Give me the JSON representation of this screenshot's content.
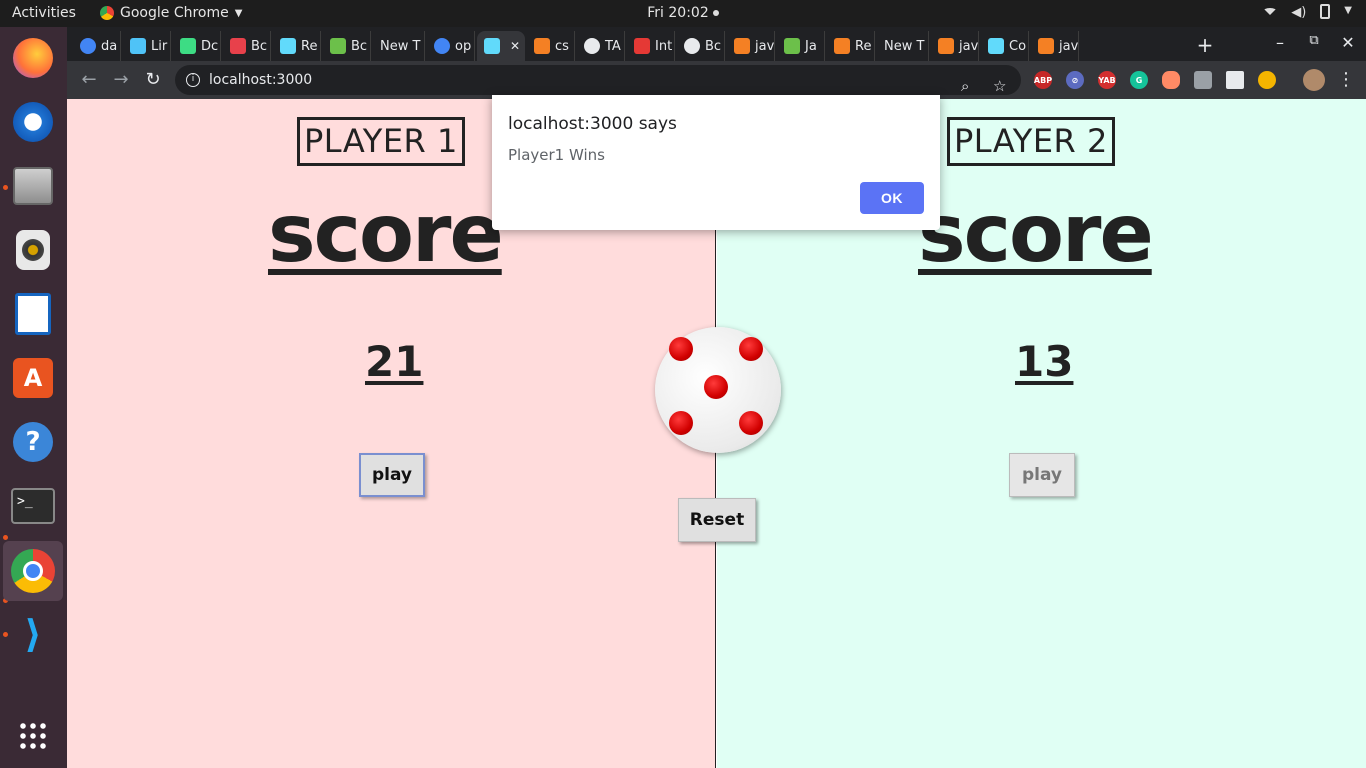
{
  "topbar": {
    "activities": "Activities",
    "app_name": "Google Chrome",
    "clock": "Fri 20:02"
  },
  "dock": {
    "apps": [
      "firefox-icon",
      "thunderbird-icon",
      "files-icon",
      "rhythmbox-icon",
      "writer-icon",
      "software-center-icon",
      "help-icon",
      "terminal-icon",
      "chrome-icon",
      "vscode-icon",
      "show-apps-icon"
    ]
  },
  "tabs": [
    {
      "label": "da",
      "icon": "google-icon",
      "color": "#4285f4"
    },
    {
      "label": "Lir",
      "icon": "flutter-icon",
      "color": "#4fc3f7"
    },
    {
      "label": "Dc",
      "icon": "android-icon",
      "color": "#3ddc84"
    },
    {
      "label": "Bc",
      "icon": "bootstrap-icon",
      "color": "#e8414b"
    },
    {
      "label": "Re",
      "icon": "react-icon",
      "color": "#61dafb"
    },
    {
      "label": "Bc",
      "icon": "chart-icon",
      "color": "#6cc04a"
    },
    {
      "label": "New T",
      "icon": "",
      "color": ""
    },
    {
      "label": "op",
      "icon": "google-icon",
      "color": "#4285f4"
    },
    {
      "label": "",
      "icon": "react-icon",
      "color": "#61dafb",
      "active": true
    },
    {
      "label": "cs",
      "icon": "stackoverflow-icon",
      "color": "#f48024"
    },
    {
      "label": "TA",
      "icon": "globe-icon",
      "color": "#e8eaed"
    },
    {
      "label": "Int",
      "icon": "arc-icon",
      "color": "#e53935"
    },
    {
      "label": "Bc",
      "icon": "globe-icon",
      "color": "#e8eaed"
    },
    {
      "label": "jav",
      "icon": "stackoverflow-icon",
      "color": "#f48024"
    },
    {
      "label": "Ja",
      "icon": "chart-icon",
      "color": "#6cc04a"
    },
    {
      "label": "Re",
      "icon": "stackoverflow-icon",
      "color": "#f48024"
    },
    {
      "label": "New T",
      "icon": "",
      "color": ""
    },
    {
      "label": "jav",
      "icon": "stackoverflow-icon",
      "color": "#f48024"
    },
    {
      "label": "Co",
      "icon": "react-icon",
      "color": "#61dafb"
    },
    {
      "label": "jav",
      "icon": "stackoverflow-icon",
      "color": "#f48024"
    }
  ],
  "toolbar": {
    "url": "localhost:3000"
  },
  "game": {
    "player1": {
      "title": "PLAYER 1",
      "score_label": "score",
      "score": "21",
      "play_label": "play",
      "bg": "#ffdcdc"
    },
    "player2": {
      "title": "PLAYER 2",
      "score_label": "score",
      "score": "13",
      "play_label": "play",
      "bg": "#e0fff4"
    },
    "dice_value": 5,
    "reset_label": "Reset"
  },
  "alert": {
    "title": "localhost:3000 says",
    "message": "Player1 Wins",
    "ok_label": "OK"
  }
}
